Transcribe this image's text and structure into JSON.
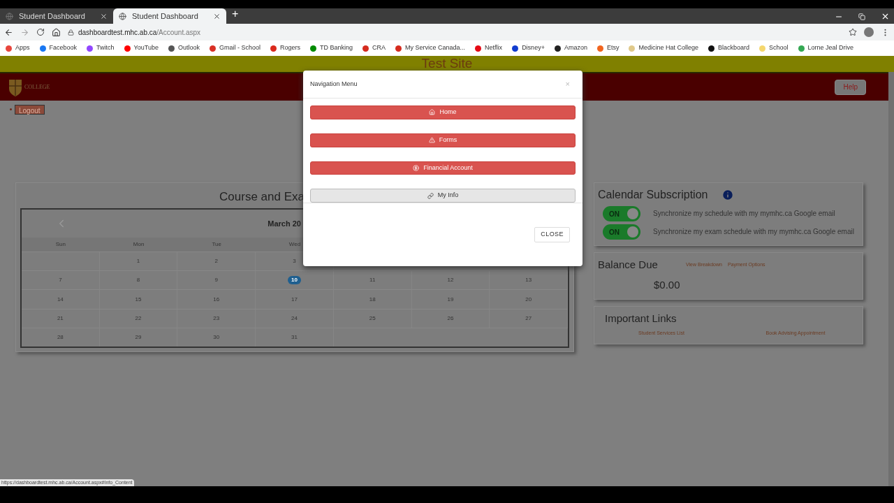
{
  "browser": {
    "tabs": [
      {
        "title": "Student Dashboard",
        "selected": false
      },
      {
        "title": "Student Dashboard",
        "selected": true
      }
    ],
    "new_tab": "+",
    "address": {
      "host": "dashboardtest.mhc.ab.ca",
      "path": "/Account.aspx"
    },
    "bookmarks": [
      {
        "label": "Apps",
        "color": "#e8453c"
      },
      {
        "label": "Facebook",
        "color": "#1877f2"
      },
      {
        "label": "Twitch",
        "color": "#9146ff"
      },
      {
        "label": "YouTube",
        "color": "#ff0000"
      },
      {
        "label": "Outlook",
        "color": "#555555"
      },
      {
        "label": "Gmail - School",
        "color": "#d93025"
      },
      {
        "label": "Rogers",
        "color": "#da291c"
      },
      {
        "label": "TD Banking",
        "color": "#008a00"
      },
      {
        "label": "CRA",
        "color": "#d52b1e"
      },
      {
        "label": "My Service Canada...",
        "color": "#d52b1e"
      },
      {
        "label": "Netflix",
        "color": "#e50914"
      },
      {
        "label": "Disney+",
        "color": "#113ccf"
      },
      {
        "label": "Amazon",
        "color": "#222222"
      },
      {
        "label": "Etsy",
        "color": "#f1641e"
      },
      {
        "label": "Medicine Hat College",
        "color": "#e0c98a"
      },
      {
        "label": "Blackboard",
        "color": "#111111"
      },
      {
        "label": "School",
        "color": "#f5d76e"
      },
      {
        "label": "Lorne Jeal Drive",
        "color": "#34a853"
      }
    ],
    "status_url": "https://dashboardtest.mhc.ab.ca/Account.aspx#Info_Content"
  },
  "site": {
    "banner": "Test Site",
    "logo_text": "COLLEGE",
    "help": "Help",
    "logout": "Logout"
  },
  "calendar": {
    "title": "Course and Exa",
    "month": "March 20",
    "weekdays": [
      "Sun",
      "Mon",
      "Tue",
      "Wed"
    ],
    "weeks": [
      {
        "leading_blank": true,
        "days": [
          {
            "day": "1",
            "today": false
          },
          {
            "day": "2",
            "today": false
          },
          {
            "day": "3",
            "today": false
          }
        ]
      },
      {
        "leading_blank": false,
        "days": [
          {
            "day": "7",
            "today": false
          },
          {
            "day": "8",
            "today": false
          },
          {
            "day": "9",
            "today": false
          },
          {
            "day": "10",
            "today": true
          },
          {
            "day": "11",
            "today": false
          },
          {
            "day": "12",
            "today": false
          },
          {
            "day": "13",
            "today": false
          }
        ]
      },
      {
        "leading_blank": false,
        "days": [
          {
            "day": "14",
            "today": false
          },
          {
            "day": "15",
            "today": false
          },
          {
            "day": "16",
            "today": false
          },
          {
            "day": "17",
            "today": false
          },
          {
            "day": "18",
            "today": false
          },
          {
            "day": "19",
            "today": false
          },
          {
            "day": "20",
            "today": false
          }
        ]
      },
      {
        "leading_blank": false,
        "days": [
          {
            "day": "21",
            "today": false
          },
          {
            "day": "22",
            "today": false
          },
          {
            "day": "23",
            "today": false
          },
          {
            "day": "24",
            "today": false
          },
          {
            "day": "25",
            "today": false
          },
          {
            "day": "26",
            "today": false
          },
          {
            "day": "27",
            "today": false
          }
        ]
      },
      {
        "leading_blank": false,
        "days": [
          {
            "day": "28",
            "today": false
          },
          {
            "day": "29",
            "today": false
          },
          {
            "day": "30",
            "today": false
          },
          {
            "day": "31",
            "today": false
          }
        ]
      }
    ]
  },
  "calendar_subscription": {
    "title": "Calendar Subscription",
    "toggles": [
      {
        "label": "Synchronize my schedule with my mymhc.ca Google email",
        "state_text": "ON",
        "on": true
      },
      {
        "label": "Synchronize my exam schedule with my mymhc.ca Google email",
        "state_text": "ON",
        "on": true
      }
    ]
  },
  "balance": {
    "title": "Balance Due",
    "links": [
      "View Breakdown",
      "Payment Options"
    ],
    "amount": "$0.00"
  },
  "important_links": {
    "title": "Important Links",
    "links": [
      "Student Services List",
      "Book Advising Appointment"
    ]
  },
  "modal": {
    "title": "Navigation Menu",
    "close_x": "×",
    "items": [
      {
        "label": "Home",
        "kind": "primary"
      },
      {
        "label": "Forms",
        "kind": "primary"
      },
      {
        "label": "Financial Account",
        "kind": "primary"
      },
      {
        "label": "My Info",
        "kind": "default"
      }
    ],
    "close": "CLOSE"
  }
}
